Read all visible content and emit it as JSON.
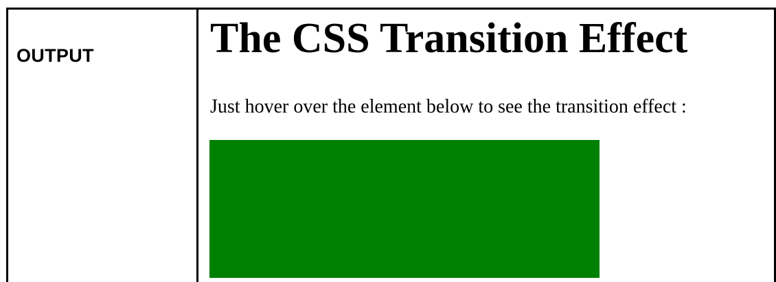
{
  "table": {
    "left_label": "OUTPUT"
  },
  "output": {
    "heading": "The CSS Transition Effect",
    "paragraph": "Just hover over the element below to see the transition effect :",
    "box_color": "#008000"
  }
}
